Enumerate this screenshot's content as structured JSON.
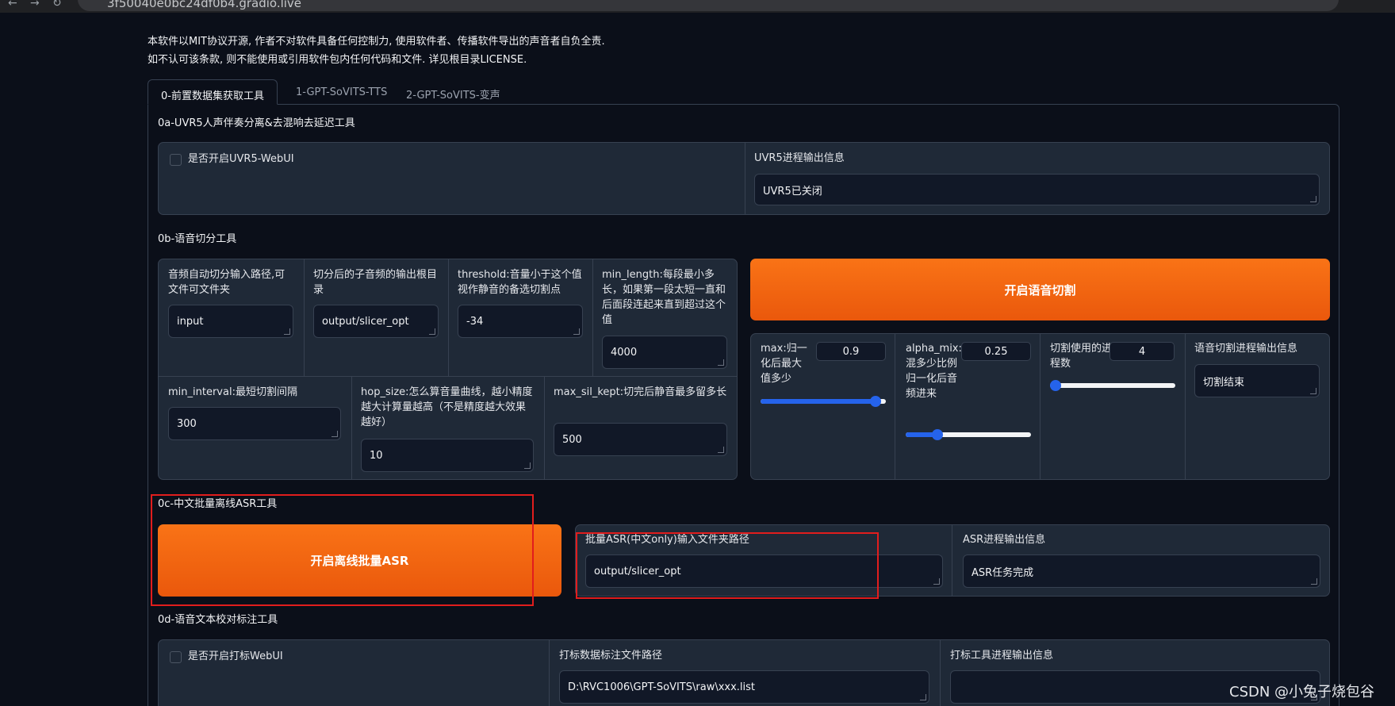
{
  "browser": {
    "url": "3f50040e0bc24df0b4.gradio.live"
  },
  "notice": {
    "line1": "本软件以MIT协议开源, 作者不对软件具备任何控制力, 使用软件者、传播软件导出的声音者自负全责.",
    "line2": "如不认可该条款, 则不能使用或引用软件包内任何代码和文件. 详见根目录LICENSE."
  },
  "tabs": [
    {
      "label": "0-前置数据集获取工具",
      "active": true
    },
    {
      "label": "1-GPT-SoVITS-TTS",
      "active": false
    },
    {
      "label": "2-GPT-SoVITS-变声",
      "active": false
    }
  ],
  "uvr5": {
    "title": "0a-UVR5人声伴奏分离&去混响去延迟工具",
    "checkbox_label": "是否开启UVR5-WebUI",
    "output_label": "UVR5进程输出信息",
    "output_value": "UVR5已关闭"
  },
  "slicer": {
    "title": "0b-语音切分工具",
    "input_path_label": "音频自动切分输入路径,可文件可文件夹",
    "input_path_value": "input",
    "output_dir_label": "切分后的子音频的输出根目录",
    "output_dir_value": "output/slicer_opt",
    "threshold_label": "threshold:音量小于这个值视作静音的备选切割点",
    "threshold_value": "-34",
    "min_length_label": "min_length:每段最小多长，如果第一段太短一直和后面段连起来直到超过这个值",
    "min_length_value": "4000",
    "min_interval_label": "min_interval:最短切割间隔",
    "min_interval_value": "300",
    "hop_size_label": "hop_size:怎么算音量曲线，越小精度越大计算量越高（不是精度越大效果越好）",
    "hop_size_value": "10",
    "max_sil_kept_label": "max_sil_kept:切完后静音最多留多长",
    "max_sil_kept_value": "500",
    "start_button": "开启语音切割",
    "max_label": "max:归一化后最大值多少",
    "max_value": "0.9",
    "max_fraction": 0.92,
    "alpha_label": "alpha_mix:混多少比例归一化后音频进来",
    "alpha_value": "0.25",
    "alpha_fraction": 0.25,
    "procs_label": "切割使用的进程数",
    "procs_value": "4",
    "procs_fraction": 0.0,
    "output_label": "语音切割进程输出信息",
    "output_value": "切割结束"
  },
  "asr": {
    "title": "0c-中文批量离线ASR工具",
    "start_button": "开启离线批量ASR",
    "input_label": "批量ASR(中文only)输入文件夹路径",
    "input_value": "output/slicer_opt",
    "output_label": "ASR进程输出信息",
    "output_value": "ASR任务完成"
  },
  "label_tool": {
    "title": "0d-语音文本校对标注工具",
    "checkbox_label": "是否开启打标WebUI",
    "path_label": "打标数据标注文件路径",
    "path_value": "D:\\RVC1006\\GPT-SoVITS\\raw\\xxx.list",
    "output_label": "打标工具进程输出信息",
    "output_value": ""
  },
  "watermark": "CSDN @小兔子烧包谷",
  "colors": {
    "background": "#0b0f19",
    "panel": "#1f2937",
    "accent": "#f97316",
    "slider": "#2563eb",
    "highlight": "#e11d1d"
  }
}
